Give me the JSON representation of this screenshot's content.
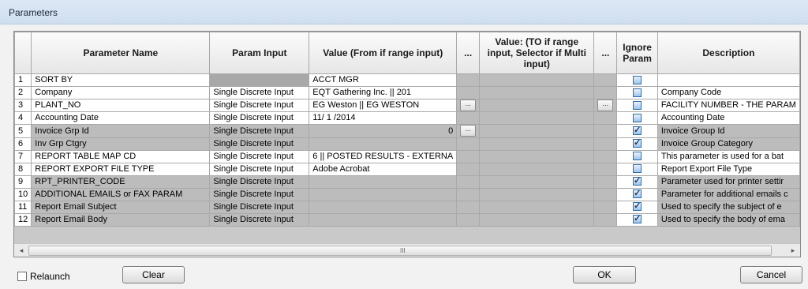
{
  "window": {
    "title": "Parameters"
  },
  "columns": {
    "row_num": "",
    "name": "Parameter Name",
    "input": "Param Input",
    "value_from": "Value (From if range input)",
    "ellipsis1": "...",
    "value_to": "Value: (TO if range input, Selector if Multi input)",
    "ellipsis2": "...",
    "ignore": "Ignore Param",
    "description": "Description"
  },
  "rows": [
    {
      "num": "1",
      "name": "SORT BY",
      "input": "",
      "value": "ACCT MGR",
      "desc": "",
      "ignore": false
    },
    {
      "num": "2",
      "name": "Company",
      "input": "Single Discrete Input",
      "value": "EQT Gathering Inc. || 201",
      "desc": "Company Code",
      "ignore": false
    },
    {
      "num": "3",
      "name": "PLANT_NO",
      "input": "Single Discrete Input",
      "value": "EG Weston || EG  WESTON",
      "desc": "FACILITY NUMBER - THE PARAM",
      "ignore": false
    },
    {
      "num": "4",
      "name": "Accounting Date",
      "input": "Single Discrete Input",
      "value": "11/ 1 /2014",
      "desc": "Accounting Date",
      "ignore": false
    },
    {
      "num": "5",
      "name": "Invoice Grp Id",
      "input": "Single Discrete Input",
      "value": "0",
      "desc": "Invoice Group Id",
      "ignore": true
    },
    {
      "num": "6",
      "name": "Inv Grp Ctgry",
      "input": "Single Discrete Input",
      "value": "",
      "desc": "Invoice Group Category",
      "ignore": true
    },
    {
      "num": "7",
      "name": "REPORT TABLE MAP CD",
      "input": "Single Discrete Input",
      "value": "6 || POSTED RESULTS - EXTERNA",
      "desc": "This parameter is used for a bat",
      "ignore": false
    },
    {
      "num": "8",
      "name": "REPORT EXPORT FILE TYPE",
      "input": "Single Discrete Input",
      "value": "Adobe Acrobat",
      "desc": "Report Export File Type",
      "ignore": false
    },
    {
      "num": "9",
      "name": "RPT_PRINTER_CODE",
      "input": "Single Discrete Input",
      "value": "",
      "desc": "Parameter used for printer settir",
      "ignore": true
    },
    {
      "num": "10",
      "name": "ADDITIONAL EMAILS or FAX PARAM",
      "input": "Single Discrete Input",
      "value": "",
      "desc": "Parameter for additional emails c",
      "ignore": true
    },
    {
      "num": "11",
      "name": "Report Email Subject",
      "input": "Single Discrete Input",
      "value": "",
      "desc": "Used to specify the subject of e",
      "ignore": true
    },
    {
      "num": "12",
      "name": "Report Email Body",
      "input": "Single Discrete Input",
      "value": "",
      "desc": "Used to specify the body of ema",
      "ignore": true
    }
  ],
  "ellipsis_button": "...",
  "scrollbar": {
    "left_arrow": "◂",
    "right_arrow": "▸",
    "grip": "III"
  },
  "footer": {
    "relaunch_label": "Relaunch",
    "relaunch_checked": false,
    "clear": "Clear",
    "ok": "OK",
    "cancel": "Cancel"
  }
}
